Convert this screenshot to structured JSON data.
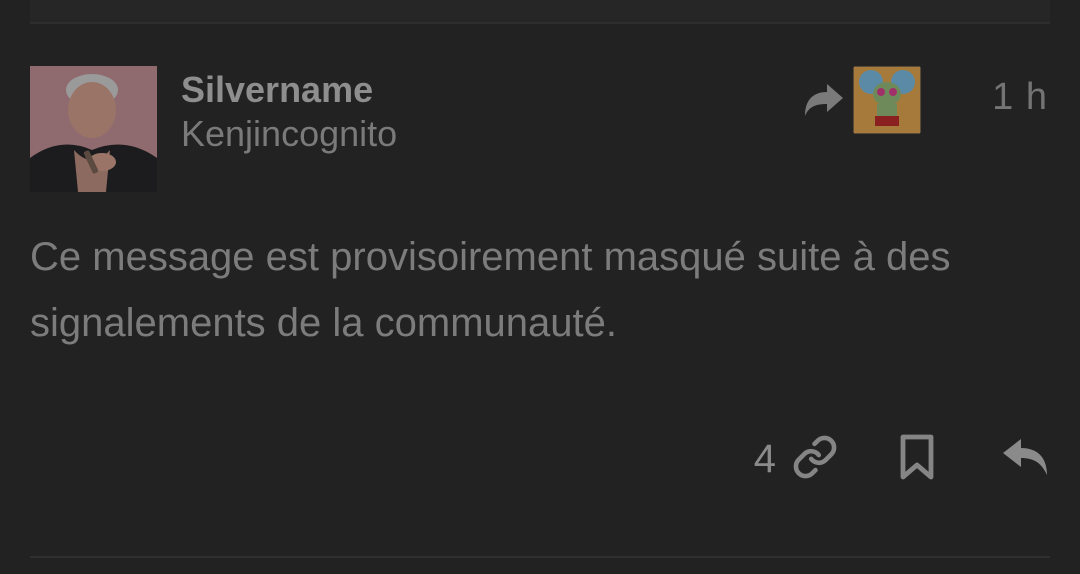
{
  "post": {
    "display_name": "Silvername",
    "handle": "Kenjincognito",
    "timestamp": "1 h",
    "content": "Ce message est provisoirement masqué suite à des signalements de la communauté.",
    "link_count": "4"
  },
  "icons": {
    "boost": "boost-arrow-icon",
    "link": "link-icon",
    "bookmark": "bookmark-icon",
    "reply": "reply-icon"
  },
  "colors": {
    "background": "#222222",
    "text_primary": "#8e8e8e",
    "text_secondary": "#7a7a7a",
    "divider": "#2f2f2f"
  }
}
